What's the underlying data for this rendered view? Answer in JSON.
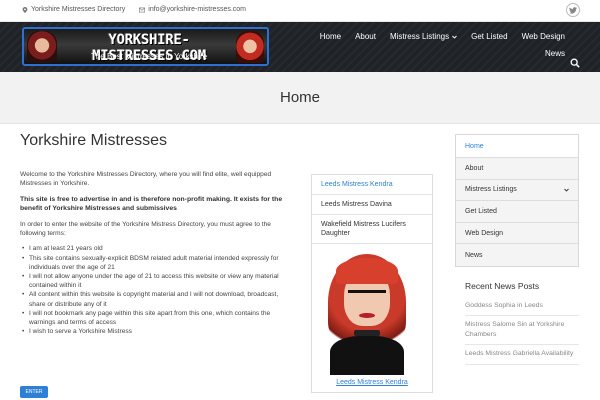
{
  "topbar": {
    "site_name": "Yorkshire Mistresses Directory",
    "email": "info@yorkshire-mistresses.com",
    "location_icon": "location-icon",
    "mail_icon": "mail-icon",
    "social_icon": "twitter-icon"
  },
  "logo": {
    "title": "YORKSHIRE-MISTRESSES.COM",
    "tagline": "The Best Mistresses in Yorkshire"
  },
  "nav": {
    "items": [
      "Home",
      "About",
      "Mistress Listings",
      "Get Listed",
      "Web Design",
      "News"
    ],
    "search_icon": "search-icon"
  },
  "page_title": "Home",
  "content": {
    "heading": "Yorkshire Mistresses",
    "intro": "Welcome to the Yorkshire Mistresses Directory, where you will find elite, well equipped Mistresses in Yorkshire.",
    "notice": "This site is free to advertise in and is therefore non-profit making. It exists for the benefit of Yorkshire Mistresses and submissives",
    "agree": "In order to enter the website of the Yorkshire Mistress Directory, you must agree to the following terms:",
    "terms": [
      "I am at least 21 years old",
      "This site contains sexually-explicit BDSM related adult material intended expressly for individuals over the age of 21",
      "I will not allow anyone under the age of 21 to access this website or view any material contained within it",
      "All content within this website is copyright material and I will not download, broadcast, share or distribute any of it",
      "I will not bookmark any page within this site apart from this one, which contains the warnings and terms of access",
      "I wish to serve a Yorkshire Mistress"
    ],
    "enter_button": "ENTER"
  },
  "listing_box": {
    "items": [
      "Leeds Mistress Kendra",
      "Leeds Mistress Davina",
      "Wakefield Mistress Lucifers Daughter"
    ],
    "caption": "Leeds Mistress Kendra"
  },
  "sidebar": {
    "menu": [
      "Home",
      "About",
      "Mistress Listings",
      "Get Listed",
      "Web Design",
      "News"
    ],
    "recent_title": "Recent News Posts",
    "recent": [
      "Goddess Sophia in Leeds",
      "Mistress Salome Sin at Yorkshire Chambers",
      "Leeds Mistress Gabriella Availability"
    ]
  },
  "colors": {
    "accent": "#2e7fd6",
    "header_bg": "#1f2227",
    "band_bg": "#f2f2f2"
  }
}
